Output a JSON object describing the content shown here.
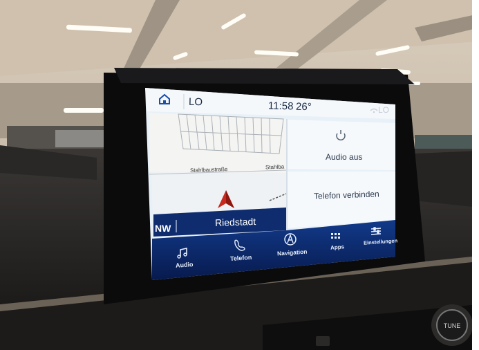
{
  "status_bar": {
    "volume_left": "LO",
    "time": "11:58",
    "temperature": "26°",
    "volume_right": "LO",
    "icons": [
      "home-icon",
      "wifi-icon"
    ]
  },
  "map": {
    "street_1": "Stahlbaustraße",
    "street_2": "Stahlba",
    "heading": "NW",
    "location": "Riedstadt",
    "icons": [
      "navigation-arrow-icon"
    ]
  },
  "panels": {
    "audio_status": "Audio aus",
    "phone_status": "Telefon verbinden",
    "icons": [
      "power-icon"
    ]
  },
  "nav_bar": {
    "items": [
      {
        "label": "Audio",
        "icon": "music-note-icon"
      },
      {
        "label": "Telefon",
        "icon": "phone-icon"
      },
      {
        "label": "Navigation",
        "icon": "navigation-icon"
      },
      {
        "label": "Apps",
        "icon": "apps-grid-icon"
      },
      {
        "label": "Einstellungen",
        "icon": "settings-sliders-icon"
      }
    ]
  },
  "hardware": {
    "knob_label": "TUNE"
  },
  "colors": {
    "screen_bg": "#e8f1f8",
    "nav_bar": "#0e2c6e",
    "nav_bar_dark": "#07194a",
    "nav_arrow": "#c8281e",
    "location_bar": "#123074"
  }
}
